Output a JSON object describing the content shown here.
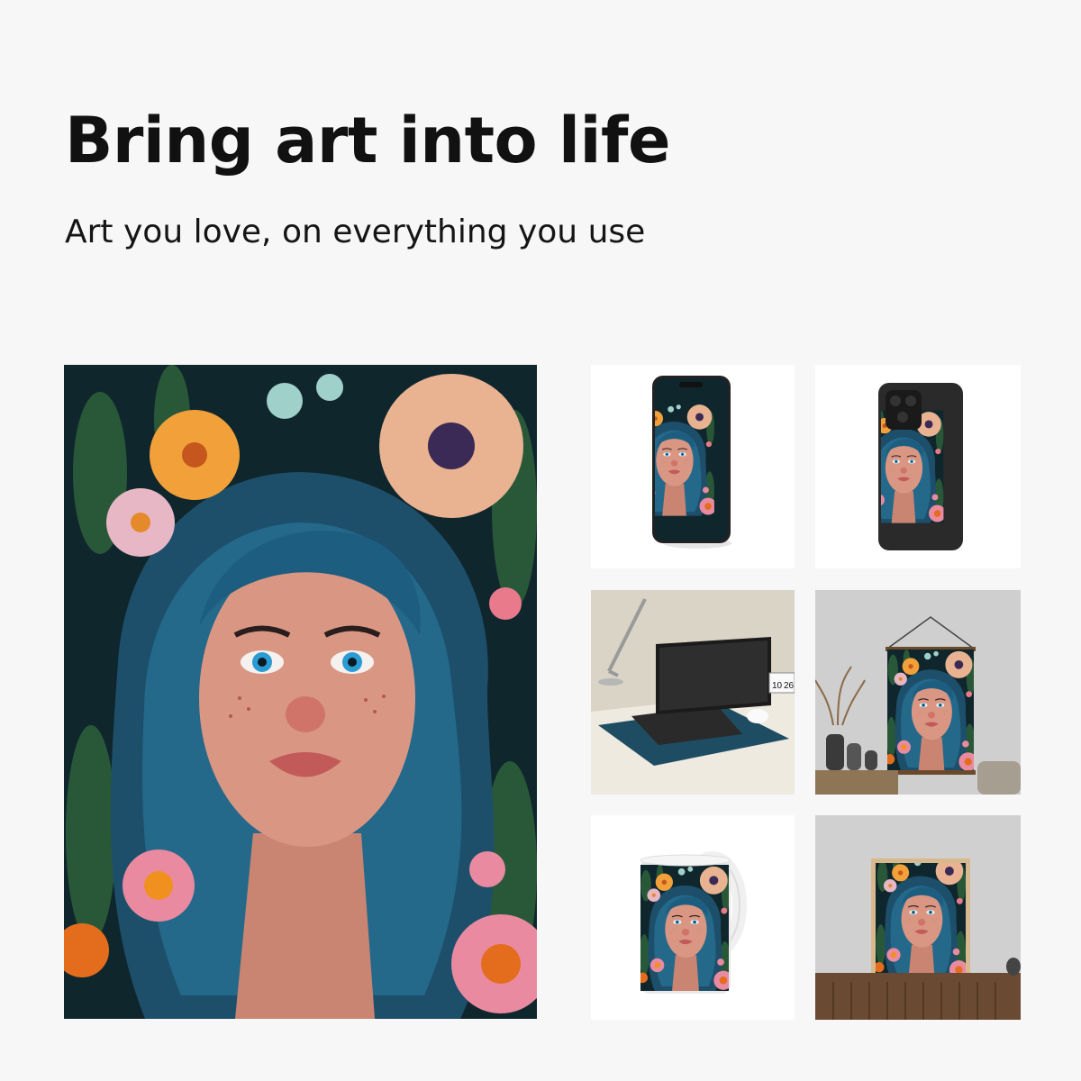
{
  "header": {
    "title": "Bring art into life",
    "subtitle": "Art you love, on everything you use"
  },
  "products": [
    {
      "name": "phone-mockup"
    },
    {
      "name": "phone-case"
    },
    {
      "name": "desk-mat"
    },
    {
      "name": "hanging-poster"
    },
    {
      "name": "mug"
    },
    {
      "name": "framed-print"
    }
  ],
  "desk_calendar": {
    "day1": "10",
    "day2": "26"
  },
  "colors": {
    "background": "#f7f7f7",
    "art_dark": "#0f2a33",
    "hair_blue": "#1f5d7a",
    "skin": "#d99783",
    "flower_orange": "#f2a13a",
    "flower_peach": "#e9b392",
    "flower_pink": "#e98aa0"
  }
}
